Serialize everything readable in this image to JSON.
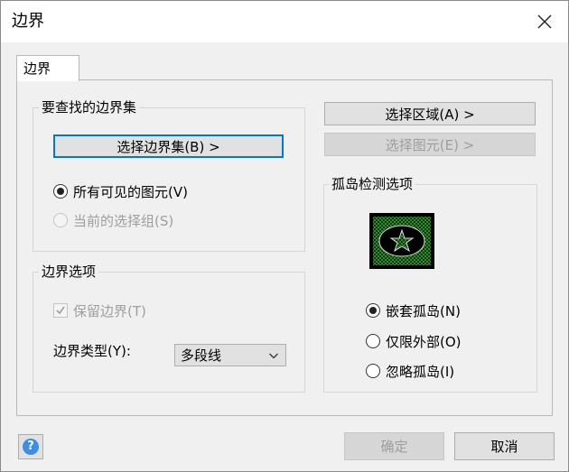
{
  "window": {
    "title": "边界"
  },
  "tabs": [
    {
      "label": "边界",
      "active": true
    }
  ],
  "boundary_set": {
    "group_label": "要查找的边界集",
    "select_button": "选择边界集(B) >",
    "options": [
      {
        "label": "所有可见的图元(V)",
        "checked": true,
        "enabled": true
      },
      {
        "label": "当前的选择组(S)",
        "checked": false,
        "enabled": false
      }
    ]
  },
  "boundary_options": {
    "group_label": "边界选项",
    "retain_checkbox": {
      "label": "保留边界(T)",
      "checked": true,
      "enabled": false
    },
    "type_label": "边界类型(Y):",
    "type_value": "多段线"
  },
  "right_buttons": {
    "select_area": "选择区域(A) >",
    "select_entity": "选择图元(E) >"
  },
  "island_detection": {
    "group_label": "孤岛检测选项",
    "options": [
      {
        "label": "嵌套孤岛(N)",
        "checked": true
      },
      {
        "label": "仅限外部(O)",
        "checked": false
      },
      {
        "label": "忽略孤岛(I)",
        "checked": false
      }
    ]
  },
  "footer": {
    "help_glyph": "?",
    "ok_label": "确定",
    "cancel_label": "取消"
  },
  "icons": {
    "close": "close-icon",
    "help": "help-icon",
    "dropdown": "chevron-down-icon",
    "preview": "island-preview-icon"
  },
  "colors": {
    "focus_border": "#0078d7",
    "preview_green": "#2e9e2e",
    "help_blue": "#3a8ee6"
  }
}
